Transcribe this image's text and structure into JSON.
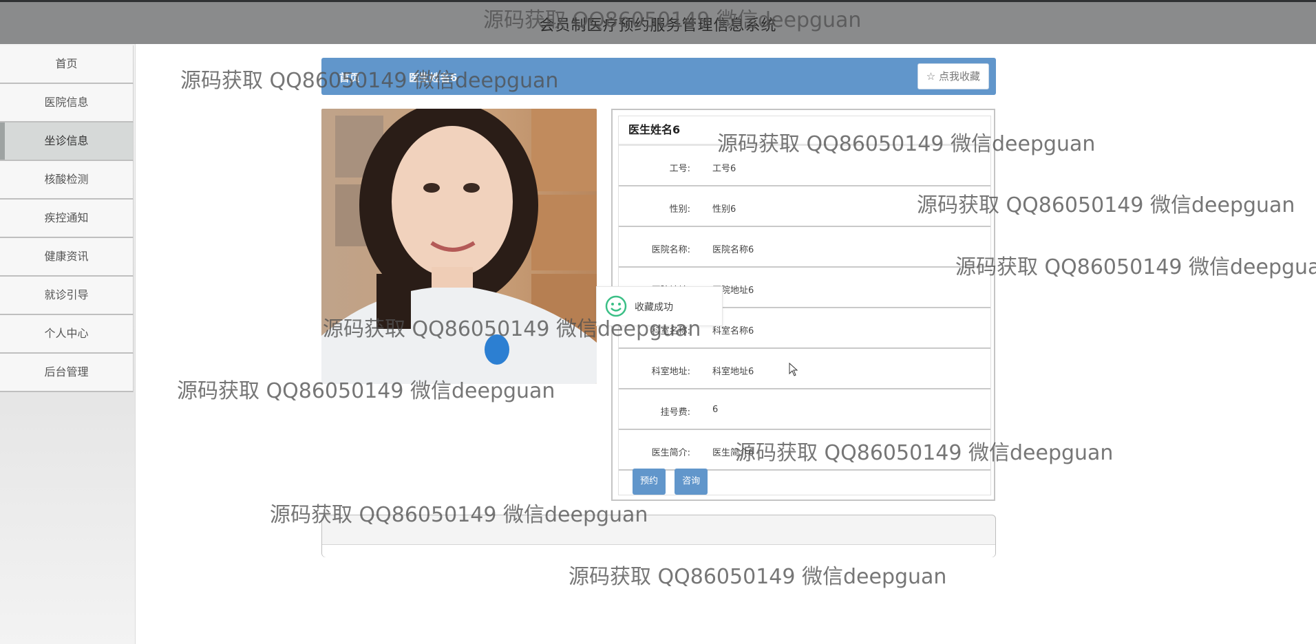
{
  "header": {
    "title": "会员制医疗预约服务管理信息系统"
  },
  "sidebar": {
    "items": [
      {
        "label": "首页"
      },
      {
        "label": "医院信息"
      },
      {
        "label": "坐诊信息",
        "active": true
      },
      {
        "label": "核酸检测"
      },
      {
        "label": "疾控通知"
      },
      {
        "label": "健康资讯"
      },
      {
        "label": "就诊引导"
      },
      {
        "label": "个人中心"
      },
      {
        "label": "后台管理"
      }
    ]
  },
  "breadcrumb": {
    "home": "首页",
    "current": "医生姓名6"
  },
  "favorite_button": {
    "icon": "star-outline-icon",
    "label": "点我收藏"
  },
  "doctor": {
    "name": "医生姓名6",
    "fields": [
      {
        "key": "工号:",
        "value": "工号6"
      },
      {
        "key": "性别:",
        "value": "性别6"
      },
      {
        "key": "医院名称:",
        "value": "医院名称6"
      },
      {
        "key": "医院地址:",
        "value": "医院地址6"
      },
      {
        "key": "科室名称:",
        "value": "科室名称6"
      },
      {
        "key": "科室地址:",
        "value": "科室地址6"
      },
      {
        "key": "挂号费:",
        "value": "6"
      },
      {
        "key": "医生简介:",
        "value": "医生简介6"
      }
    ]
  },
  "actions": {
    "book_label": "预约",
    "consult_label": "咨询"
  },
  "toast": {
    "icon": "smile-icon",
    "message": "收藏成功"
  },
  "watermark": {
    "text": "源码获取 QQ86050149 微信deepguan"
  },
  "colors": {
    "primary": "#6196cb",
    "header": "#8a8b8c",
    "toast_icon": "#3bbf86"
  }
}
